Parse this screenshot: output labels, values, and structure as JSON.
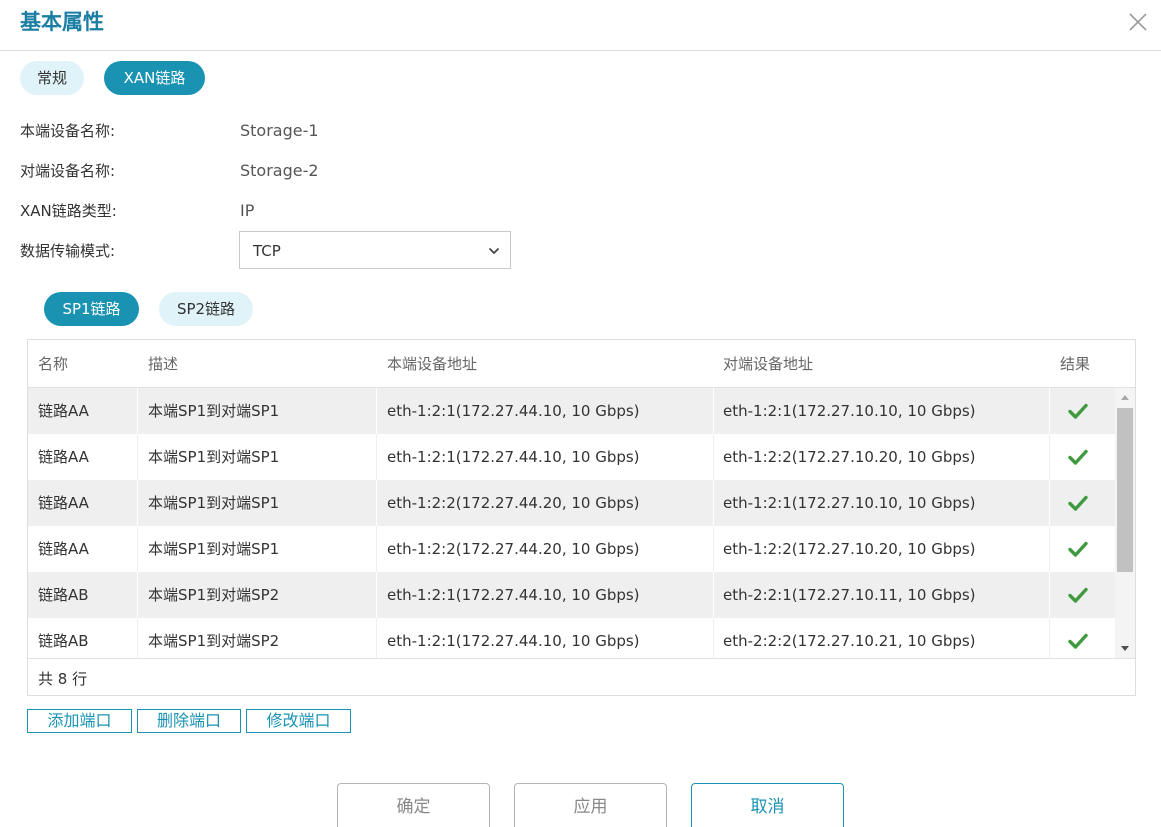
{
  "dialog": {
    "title": "基本属性",
    "close_icon": "close-icon"
  },
  "tabs": [
    {
      "label": "常规",
      "active": false
    },
    {
      "label": "XAN链路",
      "active": true
    }
  ],
  "fields": {
    "local_device_label": "本端设备名称:",
    "local_device_value": "Storage-1",
    "remote_device_label": "对端设备名称:",
    "remote_device_value": "Storage-2",
    "link_type_label": "XAN链路类型:",
    "link_type_value": "IP",
    "transfer_mode_label": "数据传输模式:",
    "transfer_mode_value": "TCP"
  },
  "sp_tabs": [
    {
      "label": "SP1链路",
      "active": true
    },
    {
      "label": "SP2链路",
      "active": false
    }
  ],
  "table": {
    "columns": [
      "名称",
      "描述",
      "本端设备地址",
      "对端设备地址",
      "结果"
    ],
    "rows": [
      {
        "name": "链路AA",
        "desc": "本端SP1到对端SP1",
        "local": "eth-1:2:1(172.27.44.10, 10 Gbps)",
        "remote": "eth-1:2:1(172.27.10.10, 10 Gbps)",
        "result": "check-icon"
      },
      {
        "name": "链路AA",
        "desc": "本端SP1到对端SP1",
        "local": "eth-1:2:1(172.27.44.10, 10 Gbps)",
        "remote": "eth-1:2:2(172.27.10.20, 10 Gbps)",
        "result": "check-icon"
      },
      {
        "name": "链路AA",
        "desc": "本端SP1到对端SP1",
        "local": "eth-1:2:2(172.27.44.20, 10 Gbps)",
        "remote": "eth-1:2:1(172.27.10.10, 10 Gbps)",
        "result": "check-icon"
      },
      {
        "name": "链路AA",
        "desc": "本端SP1到对端SP1",
        "local": "eth-1:2:2(172.27.44.20, 10 Gbps)",
        "remote": "eth-1:2:2(172.27.10.20, 10 Gbps)",
        "result": "check-icon"
      },
      {
        "name": "链路AB",
        "desc": "本端SP1到对端SP2",
        "local": "eth-1:2:1(172.27.44.10, 10 Gbps)",
        "remote": "eth-2:2:1(172.27.10.11, 10 Gbps)",
        "result": "check-icon"
      },
      {
        "name": "链路AB",
        "desc": "本端SP1到对端SP2",
        "local": "eth-1:2:1(172.27.44.10, 10 Gbps)",
        "remote": "eth-2:2:2(172.27.10.21, 10 Gbps)",
        "result": "check-icon"
      }
    ],
    "row_count": "共 8 行"
  },
  "port_buttons": [
    "添加端口",
    "删除端口",
    "修改端口"
  ],
  "dialog_buttons": {
    "ok": "确定",
    "apply": "应用",
    "cancel": "取消"
  },
  "colors": {
    "accent": "#1a93b3",
    "title": "#1b7ea3",
    "check": "#3f9a3f"
  }
}
